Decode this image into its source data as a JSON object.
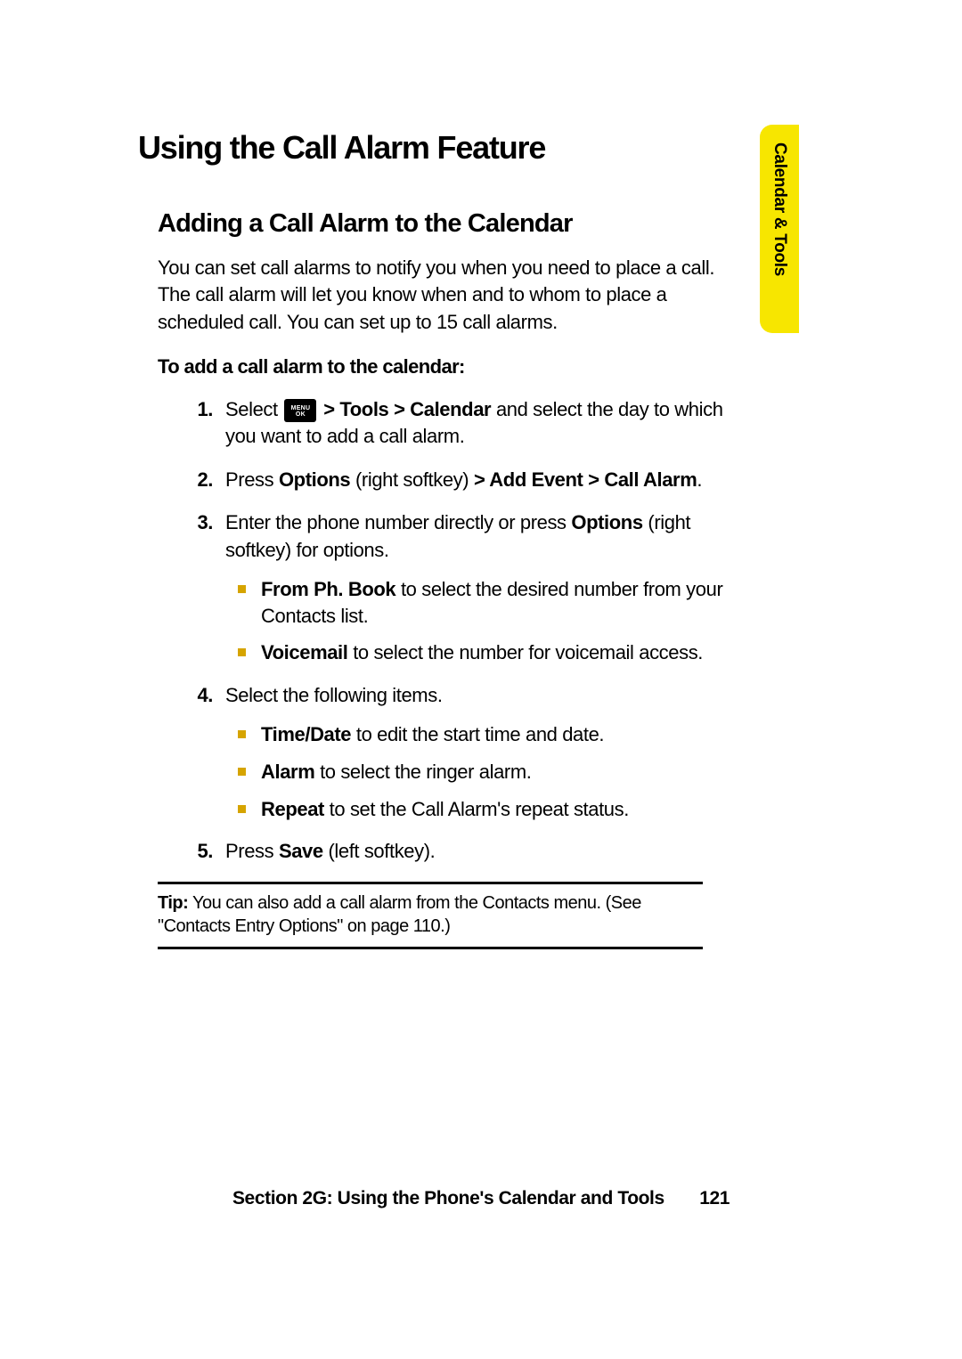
{
  "sideTab": "Calendar & Tools",
  "h1": "Using the Call Alarm Feature",
  "h2": "Adding a Call Alarm to the Calendar",
  "intro": "You can set call alarms to notify you when you need to place a call. The call alarm will let you know when and to whom to place a scheduled call. You can set up to 15 call alarms.",
  "lead": "To add a call alarm to the calendar:",
  "menuIcon": {
    "top": "MENU",
    "bottom": "OK"
  },
  "steps": {
    "s1": {
      "num": "1.",
      "pre": "Select ",
      "sep": " > ",
      "b1": "Tools",
      "b2": "Calendar",
      "post": " and select the day to which you want to add a call alarm."
    },
    "s2": {
      "num": "2.",
      "t0": "Press ",
      "b0": "Options",
      "t1": " (right softkey) ",
      "b1": "> Add Event > Call Alarm",
      "t2": "."
    },
    "s3": {
      "num": "3.",
      "t0": "Enter the phone number directly or press ",
      "b0": "Options",
      "t1": " (right softkey) for options.",
      "sub": [
        {
          "b": "From Ph. Book",
          "t": " to select the desired number from your Contacts list."
        },
        {
          "b": "Voicemail",
          "t": " to select the number for voicemail access."
        }
      ]
    },
    "s4": {
      "num": "4.",
      "t0": "Select the following items.",
      "sub": [
        {
          "b": "Time/Date",
          "t": " to edit the start time and date."
        },
        {
          "b": "Alarm",
          "t": " to select the ringer alarm."
        },
        {
          "b": "Repeat",
          "t": " to set the Call Alarm's repeat status."
        }
      ]
    },
    "s5": {
      "num": "5.",
      "t0": "Press ",
      "b0": "Save",
      "t1": " (left softkey)."
    }
  },
  "tip": {
    "label": "Tip:",
    "text": " You can also add a call alarm from the Contacts menu. (See \"Contacts Entry Options\" on page 110.)"
  },
  "footer": {
    "section": "Section 2G: Using the Phone's Calendar and Tools",
    "page": "121"
  }
}
